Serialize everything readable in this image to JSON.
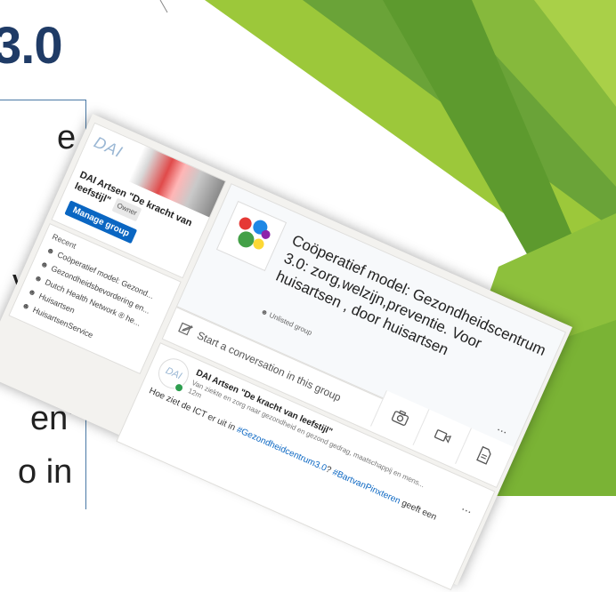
{
  "slide": {
    "title": "3.0",
    "fragments": [
      "e",
      "van",
      "en’",
      "o in"
    ]
  },
  "group_card": {
    "logo_text": "DAI",
    "name": "DAI Artsen \"De kracht van leefstijl\"",
    "owner_badge": "Owner",
    "manage_button": "Manage group"
  },
  "recent": {
    "title": "Recent",
    "items": [
      {
        "label": "Coöperatief model: Gezond...",
        "icon": "group-icon"
      },
      {
        "label": "Gezondheidsbevordering en...",
        "icon": "group-icon"
      },
      {
        "label": "Dutch Health Network ® he...",
        "icon": "group-icon"
      },
      {
        "label": "Huisartsen",
        "icon": "group-icon"
      },
      {
        "label": "HuisartsenService",
        "icon": "group-icon"
      }
    ]
  },
  "group_header": {
    "title": "Coöperatief model: Gezondheidscentrum 3.0: zorg,welzijn,preventie. Voor huisartsen , door huisartsen",
    "visibility": "Unlisted group",
    "more": "..."
  },
  "composer": {
    "placeholder": "Start a conversation in this group",
    "action_icons": [
      "camera-icon",
      "video-icon",
      "document-icon"
    ]
  },
  "post": {
    "logo_text": "DAI",
    "author": "DAI Artsen \"De kracht van leefstijl\"",
    "subtitle": "Van ziekte en zorg naar gezondheid en gezond gedrag, maatschappij en mens...",
    "time": "12m",
    "text_prefix": "Hoe ziet de ICT er uit in ",
    "hashtag1": "#Gezondheidcentrum3.0",
    "text_mid": "? ",
    "hashtag2": "#BartvanPinxteren",
    "text_suffix": " geeft een",
    "more": "..."
  },
  "colors": {
    "linkedin_blue": "#0a66c2",
    "slide_title": "#1f3b66",
    "green_dark": "#4f8f2c",
    "green_light": "#9cc83a",
    "online": "#2e9e4f"
  }
}
